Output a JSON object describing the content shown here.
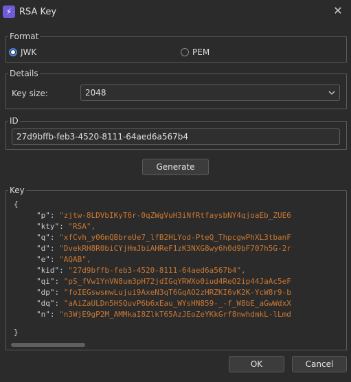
{
  "window": {
    "title": "RSA Key",
    "icon": "lightning-icon",
    "close_icon": "close-icon"
  },
  "format": {
    "legend": "Format",
    "options": [
      {
        "label": "JWK",
        "checked": true
      },
      {
        "label": "PEM",
        "checked": false
      }
    ]
  },
  "details": {
    "legend": "Details",
    "key_size_label": "Key size:",
    "key_size_value": "2048"
  },
  "id": {
    "legend": "ID",
    "value": "27d9bffb-feb3-4520-8111-64aed6a567b4"
  },
  "generate_label": "Generate",
  "key": {
    "legend": "Key",
    "open_brace": "{",
    "close_brace": "}",
    "entries": [
      {
        "key": "\"p\": ",
        "value": "\"zjtw-8LDVbIKyT6r-0qZWgVuH3iNfRtfaysbNY4qjoaEb_ZUE6"
      },
      {
        "key": "\"kty\": ",
        "value": "\"RSA\","
      },
      {
        "key": "\"q\": ",
        "value": "\"xfCvh_y06mQBbreUe7_lfB2HLYod-PteQ_ThpcgwPhXL3tbanF"
      },
      {
        "key": "\"d\": ",
        "value": "\"DvekRH8R0biCYjHmJbiAHReF1zK3NXG8wy6h0d9bF707h5G-2r"
      },
      {
        "key": "\"e\": ",
        "value": "\"AQAB\","
      },
      {
        "key": "\"kid\": ",
        "value": "\"27d9bffb-feb3-4520-8111-64aed6a567b4\","
      },
      {
        "key": "\"qi\": ",
        "value": "\"pS_fVw1YnVN8um3pH72jdIGqYRWXo0iud4ReO2ip44JaAc5eF"
      },
      {
        "key": "\"dp\": ",
        "value": "\"foIEGswsmwLujui9AxeN3qT6GqAO2zHRZKI6vK2K-YcW8r9-b"
      },
      {
        "key": "\"dq\": ",
        "value": "\"aAiZaULDn5HSQuvP6b6xEau_WYsHN859-_-f_W8bE_aGwWdxX"
      },
      {
        "key": "\"n\": ",
        "value": "\"n3WjE9gP2M_AMMkaI8ZlkT65AzJEoZeYKkGrf8nwhdmkL-lLmd"
      }
    ]
  },
  "buttons": {
    "ok": "OK",
    "cancel": "Cancel"
  }
}
